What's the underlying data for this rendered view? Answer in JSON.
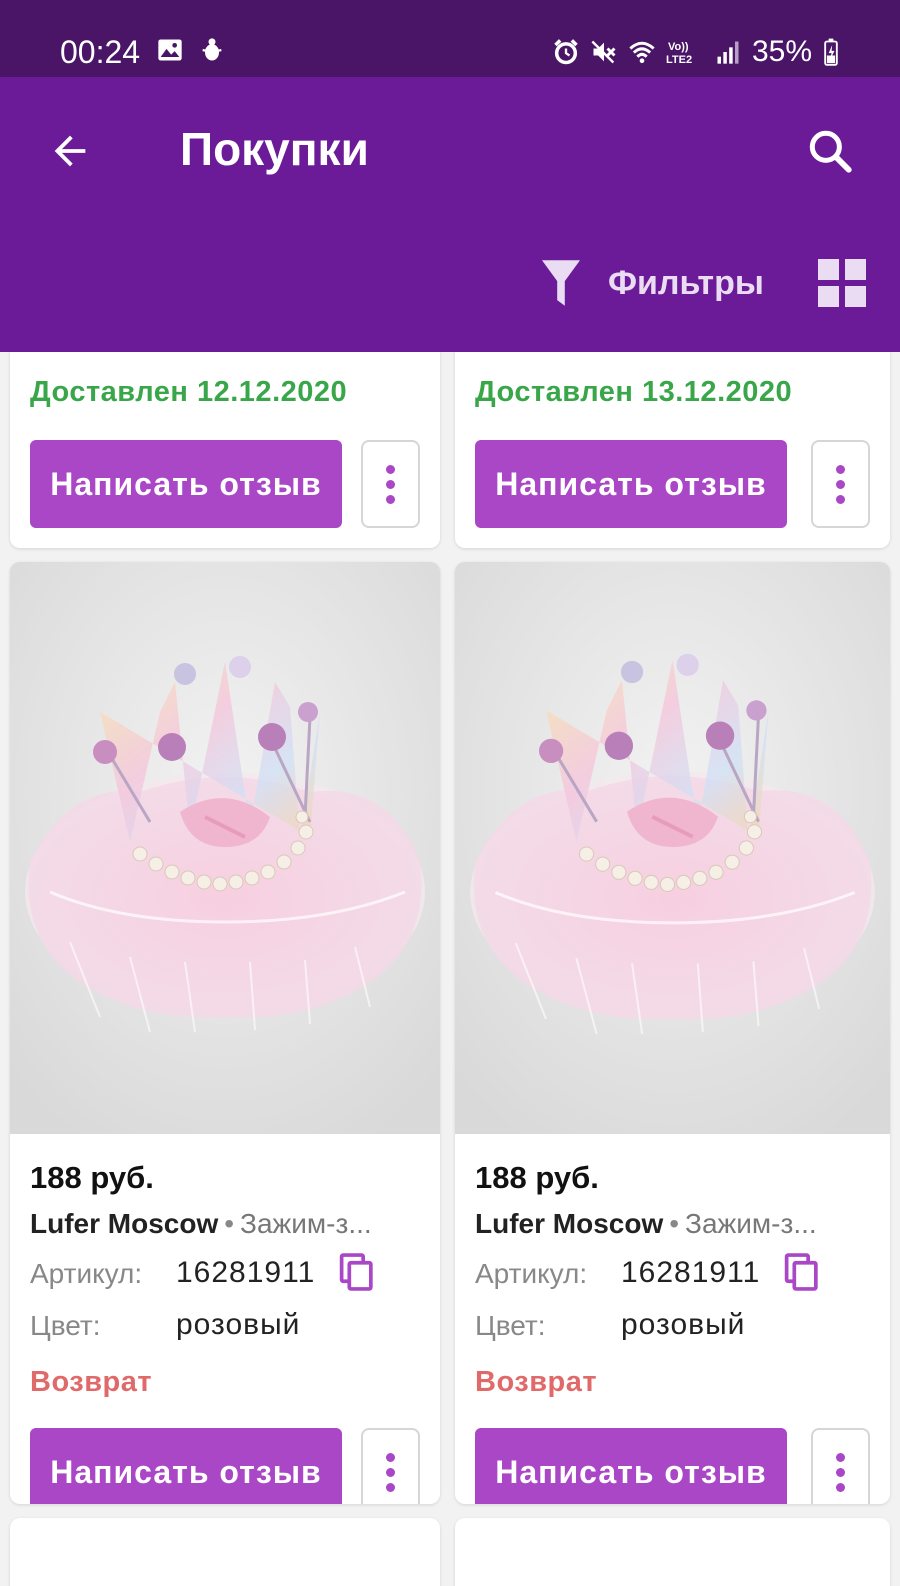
{
  "status_bar": {
    "time": "00:24",
    "battery": "35%",
    "left_icons": [
      "image-icon",
      "android-debug-icon"
    ],
    "right_icons": [
      "alarm-icon",
      "mute-icon",
      "wifi-icon",
      "volte-lte2-icon",
      "signal-icon",
      "battery-charging-icon"
    ]
  },
  "app_bar": {
    "title": "Покупки",
    "filters_label": "Фильтры",
    "back_icon": "arrow-back-icon",
    "search_icon": "search-icon",
    "filter_icon": "funnel-icon",
    "grid_icon": "grid-view-icon"
  },
  "colors": {
    "status_bar": "#4a1567",
    "app_bar": "#6c1b98",
    "accent": "#a947c6",
    "delivered": "#3aa64a",
    "return": "#e06a6a"
  },
  "top_cards": [
    {
      "delivered": "Доставлен 12.12.2020",
      "review_label": "Написать отзыв"
    },
    {
      "delivered": "Доставлен 13.12.2020",
      "review_label": "Написать отзыв"
    }
  ],
  "products": [
    {
      "price": "188 руб.",
      "brand": "Lufer Moscow",
      "name": "Зажим-з...",
      "article_label": "Артикул:",
      "article": "16281911",
      "color_label": "Цвет:",
      "color": "розовый",
      "status": "Возврат",
      "review_label": "Написать отзыв"
    },
    {
      "price": "188 руб.",
      "brand": "Lufer Moscow",
      "name": "Зажим-з...",
      "article_label": "Артикул:",
      "article": "16281911",
      "color_label": "Цвет:",
      "color": "розовый",
      "status": "Возврат",
      "review_label": "Написать отзыв"
    }
  ]
}
